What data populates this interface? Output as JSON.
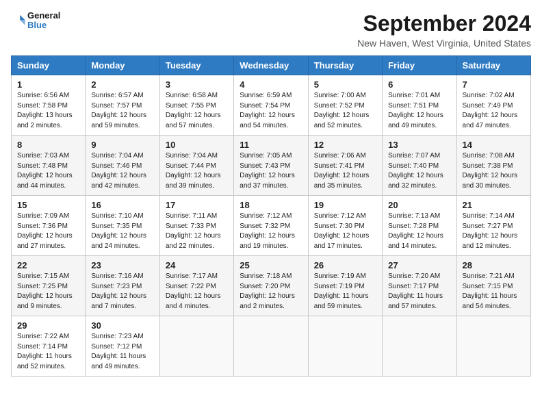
{
  "header": {
    "logo_line1": "General",
    "logo_line2": "Blue",
    "title": "September 2024",
    "subtitle": "New Haven, West Virginia, United States"
  },
  "days_of_week": [
    "Sunday",
    "Monday",
    "Tuesday",
    "Wednesday",
    "Thursday",
    "Friday",
    "Saturday"
  ],
  "weeks": [
    [
      {
        "day": "1",
        "info": "Sunrise: 6:56 AM\nSunset: 7:58 PM\nDaylight: 13 hours\nand 2 minutes."
      },
      {
        "day": "2",
        "info": "Sunrise: 6:57 AM\nSunset: 7:57 PM\nDaylight: 12 hours\nand 59 minutes."
      },
      {
        "day": "3",
        "info": "Sunrise: 6:58 AM\nSunset: 7:55 PM\nDaylight: 12 hours\nand 57 minutes."
      },
      {
        "day": "4",
        "info": "Sunrise: 6:59 AM\nSunset: 7:54 PM\nDaylight: 12 hours\nand 54 minutes."
      },
      {
        "day": "5",
        "info": "Sunrise: 7:00 AM\nSunset: 7:52 PM\nDaylight: 12 hours\nand 52 minutes."
      },
      {
        "day": "6",
        "info": "Sunrise: 7:01 AM\nSunset: 7:51 PM\nDaylight: 12 hours\nand 49 minutes."
      },
      {
        "day": "7",
        "info": "Sunrise: 7:02 AM\nSunset: 7:49 PM\nDaylight: 12 hours\nand 47 minutes."
      }
    ],
    [
      {
        "day": "8",
        "info": "Sunrise: 7:03 AM\nSunset: 7:48 PM\nDaylight: 12 hours\nand 44 minutes."
      },
      {
        "day": "9",
        "info": "Sunrise: 7:04 AM\nSunset: 7:46 PM\nDaylight: 12 hours\nand 42 minutes."
      },
      {
        "day": "10",
        "info": "Sunrise: 7:04 AM\nSunset: 7:44 PM\nDaylight: 12 hours\nand 39 minutes."
      },
      {
        "day": "11",
        "info": "Sunrise: 7:05 AM\nSunset: 7:43 PM\nDaylight: 12 hours\nand 37 minutes."
      },
      {
        "day": "12",
        "info": "Sunrise: 7:06 AM\nSunset: 7:41 PM\nDaylight: 12 hours\nand 35 minutes."
      },
      {
        "day": "13",
        "info": "Sunrise: 7:07 AM\nSunset: 7:40 PM\nDaylight: 12 hours\nand 32 minutes."
      },
      {
        "day": "14",
        "info": "Sunrise: 7:08 AM\nSunset: 7:38 PM\nDaylight: 12 hours\nand 30 minutes."
      }
    ],
    [
      {
        "day": "15",
        "info": "Sunrise: 7:09 AM\nSunset: 7:36 PM\nDaylight: 12 hours\nand 27 minutes."
      },
      {
        "day": "16",
        "info": "Sunrise: 7:10 AM\nSunset: 7:35 PM\nDaylight: 12 hours\nand 24 minutes."
      },
      {
        "day": "17",
        "info": "Sunrise: 7:11 AM\nSunset: 7:33 PM\nDaylight: 12 hours\nand 22 minutes."
      },
      {
        "day": "18",
        "info": "Sunrise: 7:12 AM\nSunset: 7:32 PM\nDaylight: 12 hours\nand 19 minutes."
      },
      {
        "day": "19",
        "info": "Sunrise: 7:12 AM\nSunset: 7:30 PM\nDaylight: 12 hours\nand 17 minutes."
      },
      {
        "day": "20",
        "info": "Sunrise: 7:13 AM\nSunset: 7:28 PM\nDaylight: 12 hours\nand 14 minutes."
      },
      {
        "day": "21",
        "info": "Sunrise: 7:14 AM\nSunset: 7:27 PM\nDaylight: 12 hours\nand 12 minutes."
      }
    ],
    [
      {
        "day": "22",
        "info": "Sunrise: 7:15 AM\nSunset: 7:25 PM\nDaylight: 12 hours\nand 9 minutes."
      },
      {
        "day": "23",
        "info": "Sunrise: 7:16 AM\nSunset: 7:23 PM\nDaylight: 12 hours\nand 7 minutes."
      },
      {
        "day": "24",
        "info": "Sunrise: 7:17 AM\nSunset: 7:22 PM\nDaylight: 12 hours\nand 4 minutes."
      },
      {
        "day": "25",
        "info": "Sunrise: 7:18 AM\nSunset: 7:20 PM\nDaylight: 12 hours\nand 2 minutes."
      },
      {
        "day": "26",
        "info": "Sunrise: 7:19 AM\nSunset: 7:19 PM\nDaylight: 11 hours\nand 59 minutes."
      },
      {
        "day": "27",
        "info": "Sunrise: 7:20 AM\nSunset: 7:17 PM\nDaylight: 11 hours\nand 57 minutes."
      },
      {
        "day": "28",
        "info": "Sunrise: 7:21 AM\nSunset: 7:15 PM\nDaylight: 11 hours\nand 54 minutes."
      }
    ],
    [
      {
        "day": "29",
        "info": "Sunrise: 7:22 AM\nSunset: 7:14 PM\nDaylight: 11 hours\nand 52 minutes."
      },
      {
        "day": "30",
        "info": "Sunrise: 7:23 AM\nSunset: 7:12 PM\nDaylight: 11 hours\nand 49 minutes."
      },
      {
        "day": "",
        "info": ""
      },
      {
        "day": "",
        "info": ""
      },
      {
        "day": "",
        "info": ""
      },
      {
        "day": "",
        "info": ""
      },
      {
        "day": "",
        "info": ""
      }
    ]
  ]
}
